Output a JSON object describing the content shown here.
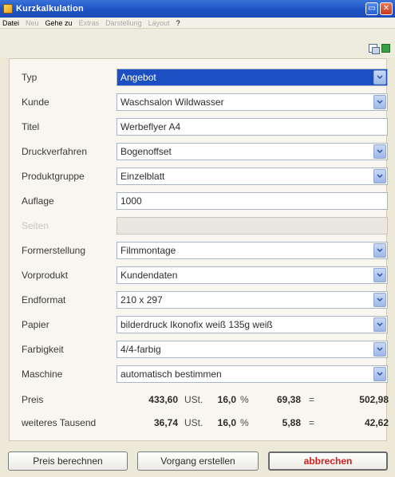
{
  "window": {
    "title": "Kurzkalkulation",
    "minimize_label": "▭",
    "close_label": "✕"
  },
  "menu": [
    {
      "label": "Datei",
      "enabled": true
    },
    {
      "label": "Neu",
      "enabled": false
    },
    {
      "label": "Gehe zu",
      "enabled": true
    },
    {
      "label": "Extras",
      "enabled": false
    },
    {
      "label": "Darstellung",
      "enabled": false
    },
    {
      "label": "Layout",
      "enabled": false
    },
    {
      "label": "?",
      "enabled": true
    }
  ],
  "form": {
    "typ": {
      "label": "Typ",
      "value": "Angebot"
    },
    "kunde": {
      "label": "Kunde",
      "value": "Waschsalon Wildwasser"
    },
    "titel": {
      "label": "Titel",
      "value": "Werbeflyer A4"
    },
    "druckverfahren": {
      "label": "Druckverfahren",
      "value": "Bogenoffset"
    },
    "produktgruppe": {
      "label": "Produktgruppe",
      "value": "Einzelblatt"
    },
    "auflage": {
      "label": "Auflage",
      "value": "1000"
    },
    "seiten": {
      "label": "Seiten",
      "value": ""
    },
    "formerstellung": {
      "label": "Formerstellung",
      "value": "Filmmontage"
    },
    "vorprodukt": {
      "label": "Vorprodukt",
      "value": "Kundendaten"
    },
    "endformat": {
      "label": "Endformat",
      "value": "210 x 297"
    },
    "papier": {
      "label": "Papier",
      "value": "bilderdruck Ikonofix weiß 135g weiß"
    },
    "farbigkeit": {
      "label": "Farbigkeit",
      "value": "4/4-farbig"
    },
    "maschine": {
      "label": "Maschine",
      "value": "automatisch bestimmen"
    }
  },
  "prices": {
    "preis": {
      "label": "Preis",
      "net": "433,60",
      "ust_label": "USt.",
      "rate": "16,0",
      "percent": "%",
      "tax": "69,38",
      "equals": "=",
      "gross": "502,98"
    },
    "tausend": {
      "label": "weiteres Tausend",
      "net": "36,74",
      "ust_label": "USt.",
      "rate": "16,0",
      "percent": "%",
      "tax": "5,88",
      "equals": "=",
      "gross": "42,62"
    }
  },
  "buttons": {
    "calculate": "Preis berechnen",
    "create": "Vorgang erstellen",
    "cancel": "abbrechen"
  },
  "colors": {
    "titlebar": "#1e52c4",
    "selection": "#1b4fc2",
    "cancel_text": "#d02020"
  }
}
